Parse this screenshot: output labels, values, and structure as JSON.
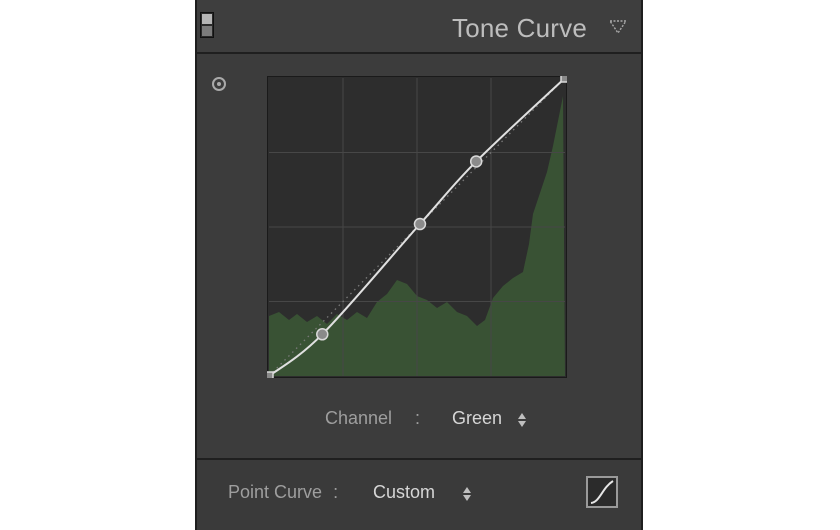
{
  "panel": {
    "title": "Tone Curve"
  },
  "icons": {
    "toggle": "panel-toggle-icon",
    "collapse": "collapse-triangle-icon",
    "target": "targeted-adjustment-icon",
    "curve_mode": "point-curve-edit-icon"
  },
  "graph": {
    "grid_divisions": 4,
    "points": [
      [
        0,
        0
      ],
      [
        0.18,
        0.14
      ],
      [
        0.51,
        0.51
      ],
      [
        0.7,
        0.72
      ],
      [
        1,
        1
      ]
    ],
    "colors": {
      "background": "#2c2c2c",
      "grid": "#3d3d3d",
      "curve": "#e6e6e6",
      "histogram": "#3c5a36"
    }
  },
  "channel": {
    "label": "Channel",
    "colon": ":",
    "value": "Green"
  },
  "point_curve": {
    "label": "Point Curve",
    "colon": ":",
    "value": "Custom"
  }
}
